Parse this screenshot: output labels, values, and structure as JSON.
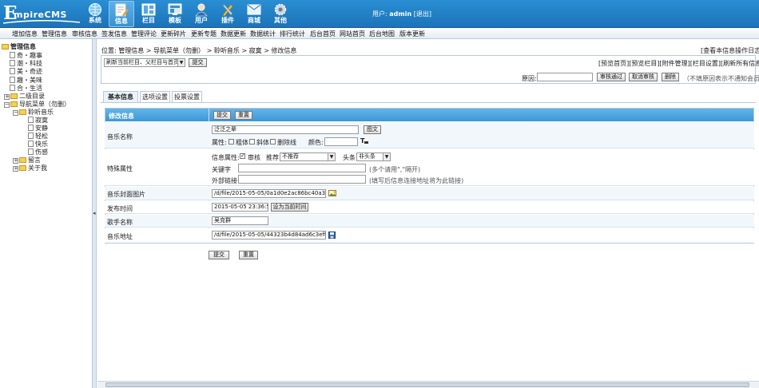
{
  "header": {
    "logo_text": "EmpireCMS",
    "nav": [
      {
        "label": "系统",
        "icon": "system-globe-icon"
      },
      {
        "label": "信息",
        "icon": "info-edit-icon",
        "active": true
      },
      {
        "label": "栏目",
        "icon": "column-icon"
      },
      {
        "label": "模板",
        "icon": "template-icon"
      },
      {
        "label": "用户",
        "icon": "user-icon"
      },
      {
        "label": "插件",
        "icon": "plugin-tools-icon"
      },
      {
        "label": "商城",
        "icon": "shop-icon"
      },
      {
        "label": "其他",
        "icon": "other-gear-icon"
      }
    ],
    "user_label": "用户:",
    "user_name": "admin",
    "logout": "[退出]"
  },
  "menubar": [
    "增加信息",
    "管理信息",
    "审核信息",
    "签发信息",
    "管理评论",
    "更新碎片",
    "更新专题",
    "数据更新",
    "数据统计",
    "排行统计",
    "后台首页",
    "网站首页",
    "后台地图",
    "版本更新"
  ],
  "tree": {
    "root": "管理信息",
    "items": [
      "奇・趣事",
      "潮・科技",
      "美・奇迹",
      "趣・美味",
      "合・生活",
      "二级目录",
      "导航菜单（勿删）",
      "聆听音乐",
      "寂寞",
      "安静",
      "轻松",
      "快乐",
      "伤感",
      "留言",
      "关于我"
    ]
  },
  "splitter_arrow": "◂",
  "breadcrumb": {
    "prefix": "位置:",
    "items": [
      "管理信息",
      "导航菜单（勿删）",
      "聆听音乐",
      "寂寞",
      "修改信息"
    ],
    "sep": ">",
    "log_link": "[查看本信息操作日志]"
  },
  "refresh": {
    "select_value": "刷新当前栏目、父栏目与首页",
    "submit": "提交",
    "links": [
      "[预览首页]",
      "[预览栏目]",
      "[附件管理]",
      "[栏目设置]",
      "[刷新所有信息JS]"
    ]
  },
  "review": {
    "reason_label": "原因:",
    "approve": "审核通过",
    "cancel": "取消审核",
    "delete": "删除",
    "note": "（不填原因表示不通知会员）"
  },
  "tabs": [
    "基本信息",
    "选项设置",
    "投票设置"
  ],
  "form": {
    "header_label": "修改信息",
    "submit": "提交",
    "reset": "重置",
    "music_name_label": "音乐名称",
    "music_name_value": "泛泛之辈",
    "img_button": "图文",
    "attr_label": "属性:",
    "attr_bold": "粗体",
    "attr_italic": "斜体",
    "attr_strike": "删除线",
    "color_label": "颜色:",
    "special_label": "特殊属性",
    "info_attr_label": "信息属性:",
    "reviewed": "审核",
    "recommend_label": "推荐",
    "recommend_value": "不推荐",
    "headline_label": "头条",
    "headline_value": "非头条",
    "keywords_label": "关键字",
    "keywords_note": "(多个请用\",\"隔开)",
    "external_label": "外部链接:",
    "external_note": "(填写后信息连接地址将为此链接)",
    "cover_label": "音乐封面图片",
    "cover_value": "/d/file/2015-05-05/0a1d0e2ac86bc40a3ad37",
    "publish_label": "发布时间",
    "publish_value": "2015-05-05 23:36:52",
    "set_now": "设为当前时间",
    "singer_label": "歌手名称",
    "singer_value": "吴克群",
    "music_url_label": "音乐地址",
    "music_url_value": "/d/file/2015-05-05/44323b4d84ad6c3effce7",
    "bottom_submit": "提交",
    "bottom_reset": "重置"
  },
  "colors": {
    "topbar": "#1f7ec6",
    "form_header": "#4aa3df",
    "row_bg": "#f2f7fc"
  }
}
